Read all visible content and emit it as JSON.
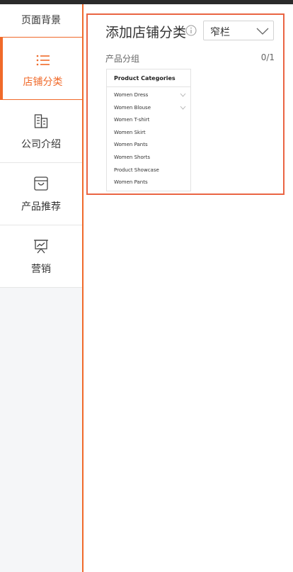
{
  "sidebar": {
    "items": [
      {
        "label": "页面背景",
        "icon": "page-background-icon"
      },
      {
        "label": "店铺分类",
        "icon": "list-icon",
        "active": true
      },
      {
        "label": "公司介绍",
        "icon": "building-icon"
      },
      {
        "label": "产品推荐",
        "icon": "shopping-bag-icon"
      },
      {
        "label": "营销",
        "icon": "presentation-board-icon"
      }
    ]
  },
  "panel": {
    "title": "添加店铺分类",
    "info_icon": "info-icon",
    "select": {
      "value": "窄栏",
      "icon": "chevron-down-icon"
    },
    "group_label": "产品分组",
    "group_count": "0/1"
  },
  "preview": {
    "title": "Product Categories",
    "items": [
      {
        "label": "Women Dress",
        "expandable": true
      },
      {
        "label": "Women Blouse",
        "expandable": true
      },
      {
        "label": "Women T-shirt",
        "expandable": false
      },
      {
        "label": "Women Skirt",
        "expandable": false
      },
      {
        "label": "Women Pants",
        "expandable": false
      },
      {
        "label": "Women Shorts",
        "expandable": false
      },
      {
        "label": "Product Showcase",
        "expandable": false
      },
      {
        "label": "Women Pants",
        "expandable": false
      }
    ]
  },
  "colors": {
    "accent": "#f06a2a",
    "panel_border": "#ea6443",
    "sidebar_bg": "#f5f6f8",
    "topbar": "#2b2b2b"
  }
}
